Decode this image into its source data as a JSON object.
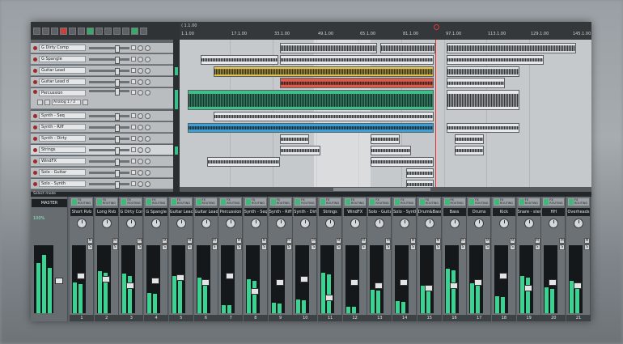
{
  "tracks": [
    {
      "name": "G Dirty Comp"
    },
    {
      "name": "G Spangle"
    },
    {
      "name": "Guitar Lead"
    },
    {
      "name": "Guitar Lead d"
    },
    {
      "name": "Percussion",
      "sub": "Analog 1 / 2"
    },
    {
      "name": "Synth - Seq"
    },
    {
      "name": "Synth - Riff"
    },
    {
      "name": "Synth - Dirty"
    },
    {
      "name": "Strings"
    },
    {
      "name": "WindFX"
    },
    {
      "name": "Solo - Guitar"
    },
    {
      "name": "Solo - Synth"
    }
  ],
  "ruler": {
    "ticks": [
      "1.1.00",
      "17.1.00",
      "33.1.00",
      "49.1.00",
      "65.1.00",
      "81.1.00",
      "97.1.00",
      "113.1.00",
      "129.1.00",
      "145.1.00"
    ]
  },
  "mixer": {
    "section_label": "Select mode",
    "master": {
      "name": "MASTER",
      "percent": "100%"
    },
    "strips": [
      {
        "name": "Short Rvb",
        "num": "1"
      },
      {
        "name": "Long Rvb",
        "num": "2"
      },
      {
        "name": "G Dirty Comp",
        "num": "3"
      },
      {
        "name": "G Spangle",
        "num": "4"
      },
      {
        "name": "Guitar Lead",
        "num": "5"
      },
      {
        "name": "Guitar Lead d",
        "num": "6"
      },
      {
        "name": "Percussion",
        "num": "7"
      },
      {
        "name": "Synth - Seq",
        "num": "8"
      },
      {
        "name": "Synth - Riff",
        "num": "9"
      },
      {
        "name": "Synth - Dirty",
        "num": "10"
      },
      {
        "name": "Strings",
        "num": "11"
      },
      {
        "name": "WindFX",
        "num": "12"
      },
      {
        "name": "Solo - Guitar",
        "num": "13"
      },
      {
        "name": "Solo - Synth",
        "num": "14"
      },
      {
        "name": "Drum&Bass",
        "num": "15"
      },
      {
        "name": "Bass",
        "num": "16"
      },
      {
        "name": "Drums",
        "num": "17"
      },
      {
        "name": "Kick",
        "num": "18"
      },
      {
        "name": "Snare - stem",
        "num": "19"
      },
      {
        "name": "HH",
        "num": "20"
      },
      {
        "name": "Overheads",
        "num": "21"
      }
    ]
  },
  "colors": {
    "accent_green": "#3cd292",
    "cursor_red": "#dd3333"
  }
}
